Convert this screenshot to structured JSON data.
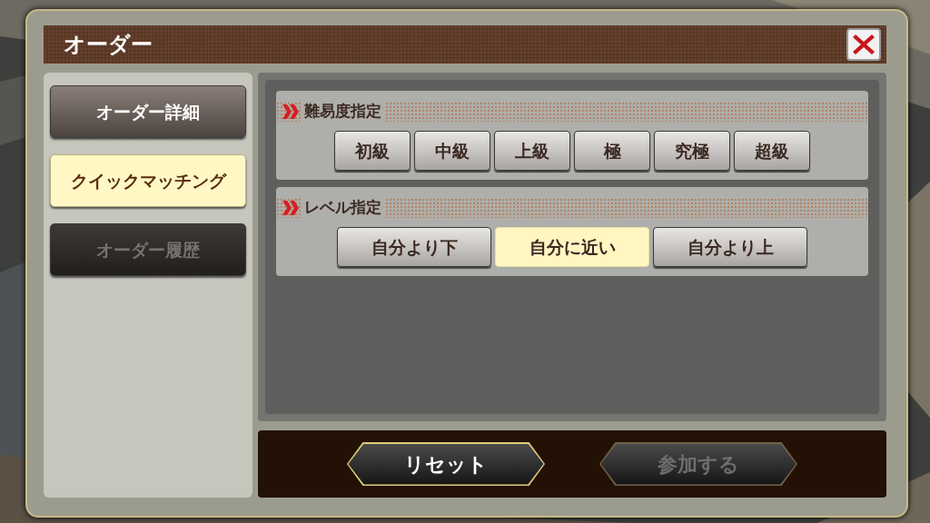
{
  "dialog": {
    "title": "オーダー"
  },
  "sidebar": {
    "items": [
      {
        "label": "オーダー詳細",
        "selected": false,
        "disabled": false
      },
      {
        "label": "クイックマッチング",
        "selected": true,
        "disabled": false
      },
      {
        "label": "オーダー履歴",
        "selected": false,
        "disabled": true
      }
    ]
  },
  "sections": [
    {
      "title": "難易度指定",
      "options": [
        {
          "label": "初級",
          "selected": false
        },
        {
          "label": "中級",
          "selected": false
        },
        {
          "label": "上級",
          "selected": false
        },
        {
          "label": "極",
          "selected": false
        },
        {
          "label": "究極",
          "selected": false
        },
        {
          "label": "超級",
          "selected": false
        }
      ]
    },
    {
      "title": "レベル指定",
      "options": [
        {
          "label": "自分より下",
          "selected": false
        },
        {
          "label": "自分に近い",
          "selected": true
        },
        {
          "label": "自分より上",
          "selected": false
        }
      ]
    }
  ],
  "footer_buttons": [
    {
      "label": "リセット",
      "disabled": false
    },
    {
      "label": "参加する",
      "disabled": true
    }
  ]
}
